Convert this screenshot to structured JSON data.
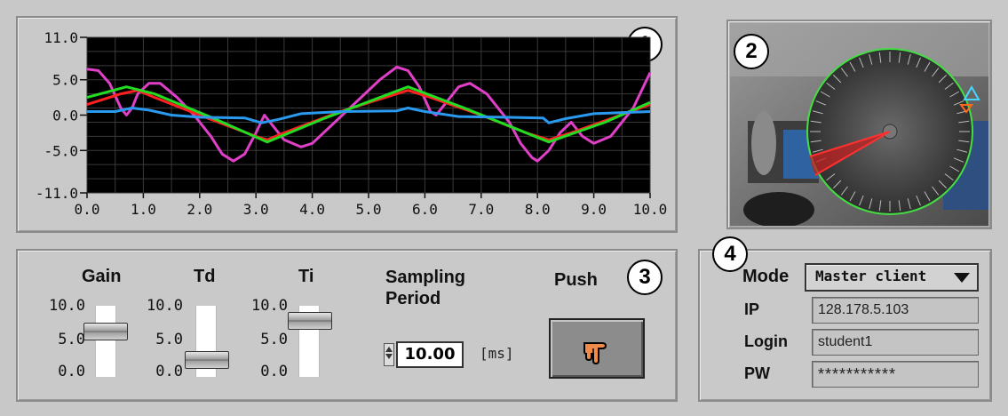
{
  "badges": {
    "graph": "1",
    "camera": "2",
    "controls": "3",
    "connection": "4"
  },
  "chart_data": {
    "type": "line",
    "xlim": [
      0,
      10
    ],
    "ylim": [
      -11,
      11
    ],
    "x_ticks": [
      "0.0",
      "1.0",
      "2.0",
      "3.0",
      "4.0",
      "5.0",
      "6.0",
      "7.0",
      "8.0",
      "9.0",
      "10.0"
    ],
    "y_ticks": [
      "11.0",
      "5.0",
      "0.0",
      "-5.0",
      "-11.0"
    ],
    "grid": true,
    "background": "#000000",
    "series": [
      {
        "color": "#e040c8",
        "points": [
          [
            0,
            6.5
          ],
          [
            0.2,
            6.3
          ],
          [
            0.4,
            4.5
          ],
          [
            0.6,
            1.0
          ],
          [
            0.7,
            0.0
          ],
          [
            0.8,
            1.0
          ],
          [
            0.9,
            3.0
          ],
          [
            1.1,
            4.5
          ],
          [
            1.3,
            4.5
          ],
          [
            1.6,
            2.5
          ],
          [
            1.9,
            0
          ],
          [
            2.2,
            -3
          ],
          [
            2.4,
            -5.5
          ],
          [
            2.6,
            -6.5
          ],
          [
            2.8,
            -5.5
          ],
          [
            3.0,
            -2.5
          ],
          [
            3.15,
            0
          ],
          [
            3.3,
            -1.5
          ],
          [
            3.5,
            -3.5
          ],
          [
            3.8,
            -4.5
          ],
          [
            4.0,
            -4.0
          ],
          [
            4.4,
            -1
          ],
          [
            4.8,
            2
          ],
          [
            5.2,
            5
          ],
          [
            5.5,
            6.8
          ],
          [
            5.7,
            6.3
          ],
          [
            5.9,
            4
          ],
          [
            6.1,
            0.5
          ],
          [
            6.2,
            0
          ],
          [
            6.35,
            1.5
          ],
          [
            6.6,
            4
          ],
          [
            6.8,
            4.5
          ],
          [
            7.1,
            3
          ],
          [
            7.5,
            -1
          ],
          [
            7.7,
            -4
          ],
          [
            7.9,
            -6
          ],
          [
            8.0,
            -6.5
          ],
          [
            8.2,
            -5
          ],
          [
            8.4,
            -2.5
          ],
          [
            8.6,
            -1
          ],
          [
            8.8,
            -3
          ],
          [
            9.0,
            -4
          ],
          [
            9.3,
            -3
          ],
          [
            9.7,
            1
          ],
          [
            10.0,
            6
          ]
        ]
      },
      {
        "color": "#ff2020",
        "points": [
          [
            0,
            1.5
          ],
          [
            0.6,
            3.0
          ],
          [
            0.9,
            3.5
          ],
          [
            1.2,
            2.5
          ],
          [
            2.0,
            0
          ],
          [
            3.0,
            -3.0
          ],
          [
            3.2,
            -3.5
          ],
          [
            3.5,
            -2.5
          ],
          [
            4.5,
            0.5
          ],
          [
            5.5,
            3.0
          ],
          [
            5.7,
            3.5
          ],
          [
            6.1,
            2.5
          ],
          [
            7.0,
            0
          ],
          [
            7.8,
            -2.5
          ],
          [
            8.2,
            -3.5
          ],
          [
            8.6,
            -2.5
          ],
          [
            9.3,
            -0.5
          ],
          [
            10,
            1.5
          ]
        ]
      },
      {
        "color": "#22dd22",
        "points": [
          [
            0,
            2.5
          ],
          [
            0.7,
            4.0
          ],
          [
            1.2,
            3.0
          ],
          [
            2.2,
            -0.3
          ],
          [
            3.2,
            -3.8
          ],
          [
            4.2,
            -0.5
          ],
          [
            5.7,
            4.0
          ],
          [
            6.7,
            1.0
          ],
          [
            8.2,
            -3.8
          ],
          [
            9.2,
            -1.0
          ],
          [
            10,
            1.8
          ]
        ]
      },
      {
        "color": "#2a9af0",
        "points": [
          [
            0,
            0.5
          ],
          [
            0.5,
            0.5
          ],
          [
            0.8,
            1.0
          ],
          [
            1.1,
            0.7
          ],
          [
            1.5,
            0
          ],
          [
            2.0,
            -0.3
          ],
          [
            2.8,
            -0.4
          ],
          [
            3.1,
            -1.1
          ],
          [
            3.4,
            -0.6
          ],
          [
            3.8,
            0.2
          ],
          [
            4.5,
            0.5
          ],
          [
            5.5,
            0.6
          ],
          [
            5.7,
            1.0
          ],
          [
            6.0,
            0.5
          ],
          [
            6.6,
            -0.2
          ],
          [
            7.4,
            -0.3
          ],
          [
            8.1,
            -0.4
          ],
          [
            8.2,
            -1.1
          ],
          [
            8.5,
            -0.5
          ],
          [
            9.0,
            0.2
          ],
          [
            10,
            0.5
          ]
        ]
      }
    ]
  },
  "controls": {
    "gain": {
      "label": "Gain",
      "scale": [
        "10.0",
        "5.0",
        "0.0"
      ],
      "value": 6.5
    },
    "td": {
      "label": "Td",
      "scale": [
        "10.0",
        "5.0",
        "0.0"
      ],
      "value": 2.5
    },
    "ti": {
      "label": "Ti",
      "scale": [
        "10.0",
        "5.0",
        "0.0"
      ],
      "value": 8.0
    },
    "sampling": {
      "label_line1": "Sampling",
      "label_line2": "Period",
      "value": "10.00",
      "unit": "[ms]"
    },
    "push": {
      "label": "Push",
      "icon": "pointing-hand-icon"
    }
  },
  "connection": {
    "mode_label": "Mode",
    "mode_value": "Master client",
    "ip_label": "IP",
    "ip_value": "128.178.5.103",
    "login_label": "Login",
    "login_value": "student1",
    "pw_label": "PW",
    "pw_value": "***********"
  }
}
